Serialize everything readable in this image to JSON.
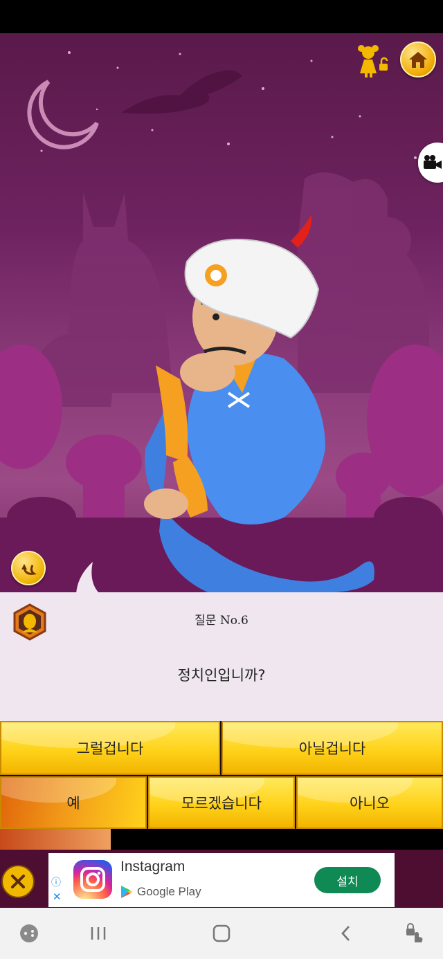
{
  "question": {
    "number_label": "질문 No.6",
    "text": "정치인입니까?"
  },
  "answers": {
    "probably": "그럴겁니다",
    "probably_not": "아닐겁니다",
    "yes": "예",
    "dont_know": "모르겠습니다",
    "no": "아니오",
    "selected": "예"
  },
  "progress": {
    "fraction": 0.25
  },
  "ad": {
    "title": "Instagram",
    "store": "Google Play",
    "install_label": "설치"
  },
  "icons": {
    "profile": "girl-profile-icon",
    "home": "home-icon",
    "video": "video-camera-icon",
    "undo": "undo-icon",
    "badge": "character-badge-icon",
    "close_ad": "close-icon"
  },
  "colors": {
    "scene": "#6e2360",
    "answer_gold": "#ffd21a",
    "selected": "#e0660a",
    "install": "#0f8a55"
  }
}
